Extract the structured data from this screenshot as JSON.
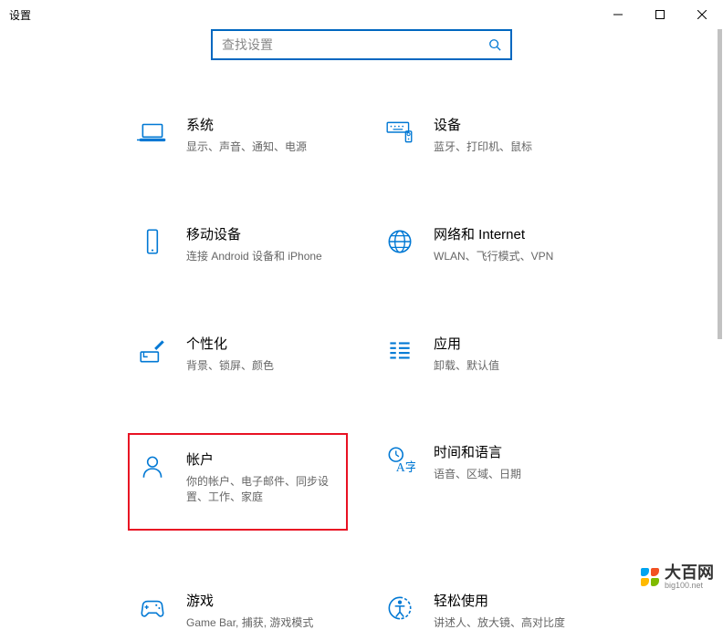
{
  "window": {
    "title": "设置"
  },
  "search": {
    "placeholder": "查找设置"
  },
  "categories": [
    {
      "id": "system",
      "title": "系统",
      "desc": "显示、声音、通知、电源",
      "icon": "laptop-icon"
    },
    {
      "id": "devices",
      "title": "设备",
      "desc": "蓝牙、打印机、鼠标",
      "icon": "keyboard-icon"
    },
    {
      "id": "phone",
      "title": "移动设备",
      "desc": "连接 Android 设备和 iPhone",
      "icon": "phone-icon"
    },
    {
      "id": "network",
      "title": "网络和 Internet",
      "desc": "WLAN、飞行模式、VPN",
      "icon": "globe-icon"
    },
    {
      "id": "personal",
      "title": "个性化",
      "desc": "背景、锁屏、颜色",
      "icon": "brush-icon"
    },
    {
      "id": "apps",
      "title": "应用",
      "desc": "卸载、默认值",
      "icon": "apps-icon"
    },
    {
      "id": "accounts",
      "title": "帐户",
      "desc": "你的帐户、电子邮件、同步设置、工作、家庭",
      "icon": "person-icon",
      "highlight": true
    },
    {
      "id": "time",
      "title": "时间和语言",
      "desc": "语音、区域、日期",
      "icon": "time-lang-icon"
    },
    {
      "id": "gaming",
      "title": "游戏",
      "desc": "Game Bar, 捕获, 游戏模式",
      "icon": "gamepad-icon"
    },
    {
      "id": "ease",
      "title": "轻松使用",
      "desc": "讲述人、放大镜、高对比度",
      "icon": "ease-icon"
    }
  ],
  "watermark": {
    "main": "大百网",
    "sub": "big100.net"
  }
}
